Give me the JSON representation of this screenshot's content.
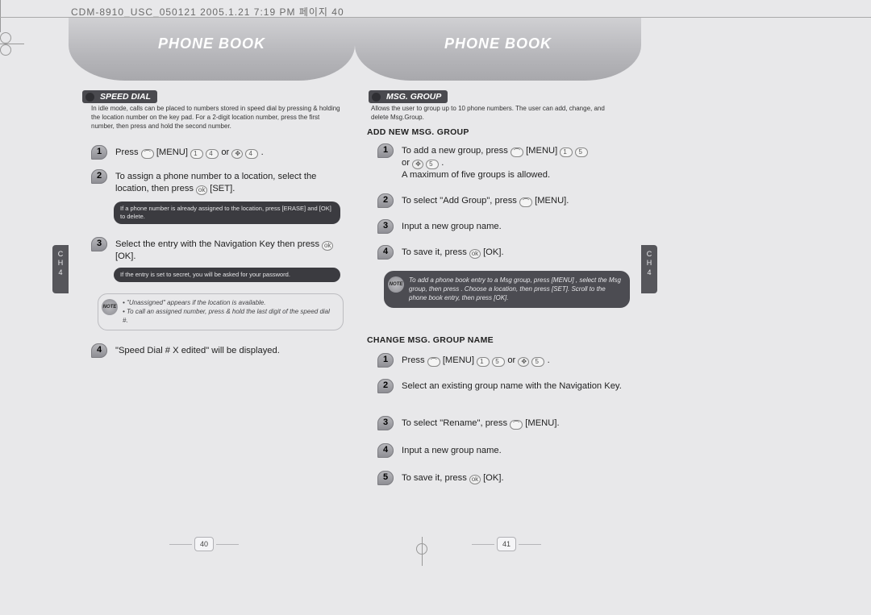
{
  "header_line": "CDM-8910_USC_050121  2005.1.21  7:19 PM  페이지 40",
  "banner_title": "PHONE BOOK",
  "side_tab": {
    "chapter_label": "C\nH",
    "chapter_num": "4"
  },
  "left": {
    "section": "SPEED DIAL",
    "intro": "In idle mode, calls can be placed to numbers stored in speed dial by pressing & holding the location number on the key pad. For a 2-digit location number, press the first number, then press and hold the second number.",
    "steps": {
      "s1": {
        "n": "1",
        "pre": "Press ",
        "menu": "[MENU]",
        "mid": " or ",
        "end": "."
      },
      "s2": {
        "n": "2",
        "pre": "To assign a phone number to a location, select the location, then press ",
        "set": "[SET].",
        "note": "If a phone number is already assigned to the location, press      [ERASE] and      [OK] to delete."
      },
      "s3": {
        "n": "3",
        "pre": "Select the entry with the Navigation Key then press ",
        "ok": "[OK].",
        "note": "If the entry is set to secret, you will be asked for your password."
      },
      "note_badge": "NOTE",
      "note_lines": [
        "\"Unassigned\" appears if the location is available.",
        "To call an assigned number, press & hold the last digit of the speed dial #."
      ],
      "s4": {
        "n": "4",
        "txt": "\"Speed Dial # X edited\" will be displayed."
      }
    },
    "page_num": "40"
  },
  "right": {
    "section": "MSG. GROUP",
    "intro": "Allows the user to group up to 10 phone numbers. The user can add, change, and delete Msg.Group.",
    "sub1": "ADD NEW MSG. GROUP",
    "add": {
      "s1": {
        "n": "1",
        "pre": "To add a new group, press ",
        "menu": "[MENU]",
        "mid": " or ",
        "end": ".",
        "line2": "A maximum of five groups is allowed."
      },
      "s2": {
        "n": "2",
        "pre": "To select \"Add Group\", press ",
        "menu": "[MENU]."
      },
      "s3": {
        "n": "3",
        "txt": "Input a new group name."
      },
      "s4": {
        "n": "4",
        "pre": "To save it, press ",
        "ok": "[OK]."
      }
    },
    "note_badge": "NOTE",
    "note_dark": "To add a phone book entry to a Msg group, press      [MENU]          , select the Msg group, then press      . Choose a location, then press      [SET]. Scroll to the phone book entry, then press      [OK].",
    "sub2": "CHANGE MSG. GROUP NAME",
    "change": {
      "s1": {
        "n": "1",
        "pre": "Press ",
        "menu": "[MENU]",
        "mid": " or ",
        "end": "."
      },
      "s2": {
        "n": "2",
        "txt": "Select an existing group name with the Navigation Key."
      },
      "s3": {
        "n": "3",
        "pre": "To select \"Rename\", press ",
        "menu": "[MENU]."
      },
      "s4": {
        "n": "4",
        "txt": "Input a new group name."
      },
      "s5": {
        "n": "5",
        "pre": "To save it, press ",
        "ok": "[OK]."
      }
    },
    "page_num": "41"
  }
}
